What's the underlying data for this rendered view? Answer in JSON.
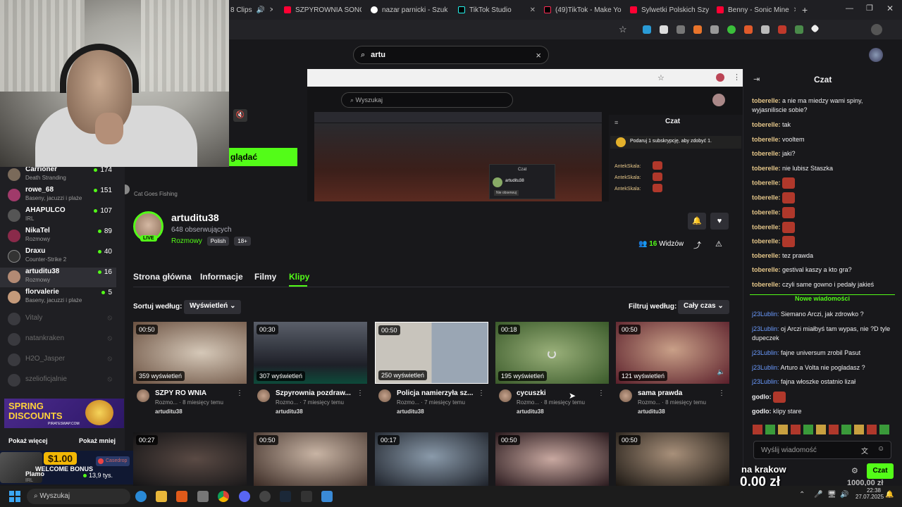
{
  "browser": {
    "tabs": [
      {
        "label": "8 Clips",
        "color": "#bbbbbb"
      },
      {
        "label": "SZPYROWNIA SONG",
        "color": "#ff0033"
      },
      {
        "label": "nazar parnicki - Szuk",
        "color": "#ffffff"
      },
      {
        "label": "TikTok Studio",
        "color": "#111111"
      },
      {
        "label": "(49)TikTok - Make Yo",
        "color": "#111111"
      },
      {
        "label": "Sylwetki Polskich Szy",
        "color": "#ff0033"
      },
      {
        "label": "Benny - Sonic Mine",
        "color": "#ff0033"
      }
    ]
  },
  "search": {
    "value": "artu",
    "clear": "×"
  },
  "preview": {
    "inner_search_placeholder": "Wyszukaj",
    "inner_chat_title": "Czat",
    "inner_sub_promo": "Podaruj 1 subskrypcję, aby zdobyć 1.",
    "inner_chat_users": [
      "AntekSkala:",
      "AntekSkala:",
      "AntekSkala:"
    ],
    "inner_label_chat": "Czat",
    "inner_channel": "artuditu38",
    "inner_follow": "Nie obserwuj"
  },
  "watch_button": "glądać",
  "sidebar": {
    "top_partial": {
      "game": "Cat Goes Fishing"
    },
    "channels": [
      {
        "name": "Carrioner",
        "game": "Death Stranding",
        "viewers": "174",
        "color": "#7a6a5a"
      },
      {
        "name": "rowe_68",
        "game": "Baseny, jacuzzi i plaże",
        "viewers": "151",
        "color": "#a03a6a"
      },
      {
        "name": "AHAPULCO",
        "game": "IRL",
        "viewers": "107",
        "color": "#555555"
      },
      {
        "name": "NikaTel",
        "game": "Rozmowy",
        "viewers": "89",
        "color": "#8a2a4a"
      },
      {
        "name": "Draxu",
        "game": "Counter-Strike 2",
        "viewers": "40",
        "color": "#333333"
      },
      {
        "name": "artuditu38",
        "game": "Rozmowy",
        "viewers": "16",
        "color": "#b38a74"
      },
      {
        "name": "florvalerie",
        "game": "Baseny, jacuzzi i plaże",
        "viewers": "5",
        "color": "#c49a7a"
      }
    ],
    "offline": [
      "Vitaly",
      "natankraken",
      "H2O_Jasper",
      "szelioficjalnie"
    ],
    "show_more": "Pokaż więcej",
    "show_less": "Pokaż mniej",
    "bottom_partial": {
      "name": "Plamo",
      "game": "IRL",
      "viewers": "13,9 tys."
    }
  },
  "ad": {
    "line1": "SPRING",
    "line2": "DISCOUNTS",
    "site": "PIRATESWAP.COM",
    "bonus_amount": "$1.00",
    "bonus_label": "WELCOME BONUS",
    "brand": "Casedrop"
  },
  "channel": {
    "name": "artuditu38",
    "followers": "648 obserwujących",
    "live_badge": "LIVE",
    "category": "Rozmowy",
    "tags": [
      "Polish",
      "18+"
    ],
    "viewers_count": "16",
    "viewers_label": "Widzów"
  },
  "tabs": [
    "Strona główna",
    "Informacje",
    "Filmy",
    "Klipy"
  ],
  "filters": {
    "sort_label": "Sortuj według:",
    "sort_value": "Wyświetleń",
    "filter_label": "Filtruj według:",
    "filter_value": "Cały czas"
  },
  "clips": [
    {
      "duration": "00:50",
      "views": "359 wyświetleń",
      "title": "SZPY RO WNIA",
      "meta": "Rozmo... · 8 miesięcy temu",
      "channel": "artuditu38",
      "bg": "#7a5a4a"
    },
    {
      "duration": "00:30",
      "views": "307 wyświetleń",
      "title": "Szpyrownia pozdraw...",
      "meta": "Rozmo... · 7 miesięcy temu",
      "channel": "artuditu38",
      "bg": "#3a3a44"
    },
    {
      "duration": "00:50",
      "views": "250 wyświetleń",
      "title": "Policja namierzyła sz...",
      "meta": "Rozmo... · 7 miesięcy temu",
      "channel": "artuditu38",
      "bg": "#8a8f96"
    },
    {
      "duration": "00:18",
      "views": "195 wyświetleń",
      "title": "cycuszki",
      "meta": "Rozmo... · 8 miesięcy temu",
      "channel": "artuditu38",
      "bg": "#4a6a3a"
    },
    {
      "duration": "00:50",
      "views": "121 wyświetleń",
      "title": "sama prawda",
      "meta": "Rozmo... · 8 miesięcy temu",
      "channel": "artuditu38",
      "bg": "#6a2a3a"
    }
  ],
  "clips_row2": [
    {
      "duration": "00:27",
      "bg": "#2a2a30"
    },
    {
      "duration": "00:50",
      "bg": "#5a4a3a"
    },
    {
      "duration": "00:17",
      "bg": "#2a2e3a"
    },
    {
      "duration": "00:50",
      "bg": "#3a2a2e"
    },
    {
      "duration": "00:50",
      "bg": "#2e2a24"
    }
  ],
  "chat": {
    "title": "Czat",
    "messages": [
      {
        "user": "toberelle:",
        "text": "a nie ma miedzy wami spiny, wyjasniliscie sobie?"
      },
      {
        "user": "toberelle:",
        "text": "tak"
      },
      {
        "user": "toberelle:",
        "text": "vooltem"
      },
      {
        "user": "toberelle:",
        "text": "jaki?"
      },
      {
        "user": "toberelle:",
        "text": "nie lubisz Staszka"
      },
      {
        "user": "toberelle:",
        "text": ""
      },
      {
        "user": "toberelle:",
        "text": ""
      },
      {
        "user": "toberelle:",
        "text": ""
      },
      {
        "user": "toberelle:",
        "text": ""
      },
      {
        "user": "toberelle:",
        "text": ""
      },
      {
        "user": "toberelle:",
        "text": "tez prawda"
      },
      {
        "user": "toberelle:",
        "text": "gestival kaszy a kto gra?"
      },
      {
        "user": "toberelle:",
        "text": "czyli same gowno i pedały jakieś"
      }
    ],
    "new_messages": "Nowe wiadomości",
    "new": [
      {
        "user": "j23Lublin:",
        "text": "Siemano Arczi, jak zdrowko ?"
      },
      {
        "user": "j23Lublin:",
        "text": "oj Arczi miałbyś tam wypas, nie ?D tyle dupeczek"
      },
      {
        "user": "j23Lublin:",
        "text": "fajne universum zrobil Pasut"
      },
      {
        "user": "j23Lublin:",
        "text": "Arturo a Volta nie pogladasz ?"
      },
      {
        "user": "j23Lublin:",
        "text": "fajna włoszke ostatnio lizał"
      },
      {
        "user": "godlo:",
        "text": ""
      },
      {
        "user": "godlo:",
        "text": "klipy stare"
      }
    ],
    "input_placeholder": "Wyślij wiadomość",
    "send": "Czat"
  },
  "overlay": {
    "line1": "na krakow",
    "amount": "0,00 zł",
    "goal": "1000,00 zł"
  },
  "taskbar": {
    "search": "Wyszukaj",
    "time": "22:38",
    "date": "27.07.2025"
  }
}
